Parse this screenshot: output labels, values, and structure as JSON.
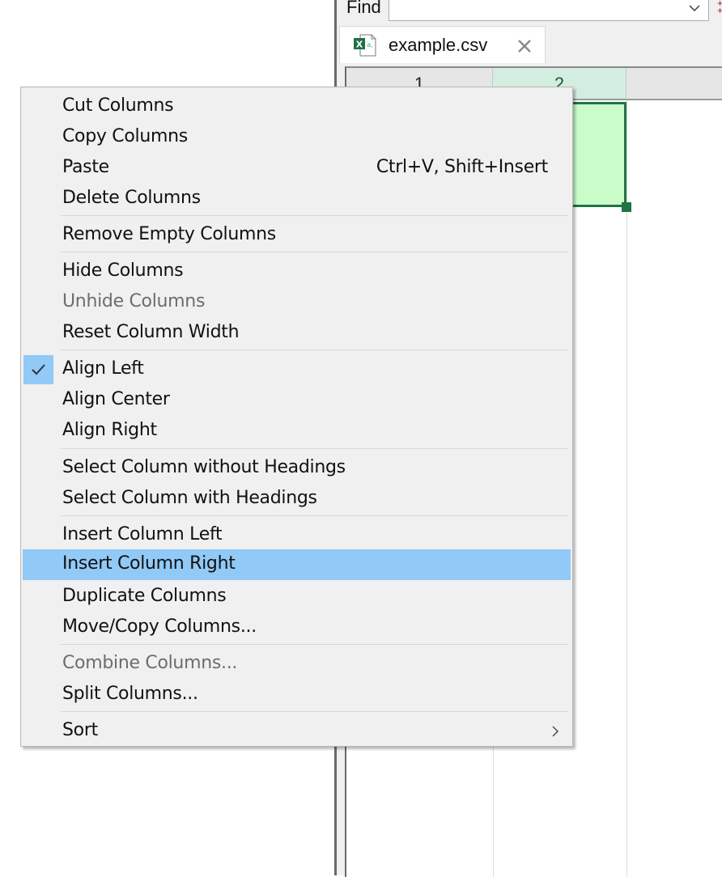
{
  "find_bar": {
    "label": "Find",
    "value": "",
    "dropdown_icon": "chevron-down-icon"
  },
  "tabs": [
    {
      "label": "example.csv",
      "icon": "excel-csv-file-icon",
      "close_icon": "close-icon",
      "active": true
    }
  ],
  "grid": {
    "column_headers": [
      "1",
      "2",
      ""
    ],
    "selected_column": "2"
  },
  "colors": {
    "menu_background": "#f0f0f0",
    "menu_highlight": "#91c9f7",
    "selected_cell_fill": "#c9fcc9",
    "selection_border": "#217346",
    "selected_header_fill": "#d3eee0",
    "disabled_text": "#6d6d6d"
  },
  "context_menu": {
    "items": [
      {
        "label": "Cut Columns"
      },
      {
        "label": "Copy Columns"
      },
      {
        "label": "Paste",
        "shortcut": "Ctrl+V, Shift+Insert"
      },
      {
        "label": "Delete Columns"
      },
      {
        "label": "Remove Empty Columns"
      },
      {
        "label": "Hide Columns"
      },
      {
        "label": "Unhide Columns",
        "disabled": true
      },
      {
        "label": "Reset Column Width"
      },
      {
        "label": "Align Left",
        "checked": true
      },
      {
        "label": "Align Center"
      },
      {
        "label": "Align Right"
      },
      {
        "label": "Select Column without Headings"
      },
      {
        "label": "Select Column with Headings"
      },
      {
        "label": "Insert Column Left"
      },
      {
        "label": "Insert Column Right",
        "highlighted": true
      },
      {
        "label": "Duplicate Columns"
      },
      {
        "label": "Move/Copy Columns..."
      },
      {
        "label": "Combine Columns...",
        "disabled": true
      },
      {
        "label": "Split Columns..."
      },
      {
        "label": "Sort",
        "submenu": true
      }
    ]
  }
}
